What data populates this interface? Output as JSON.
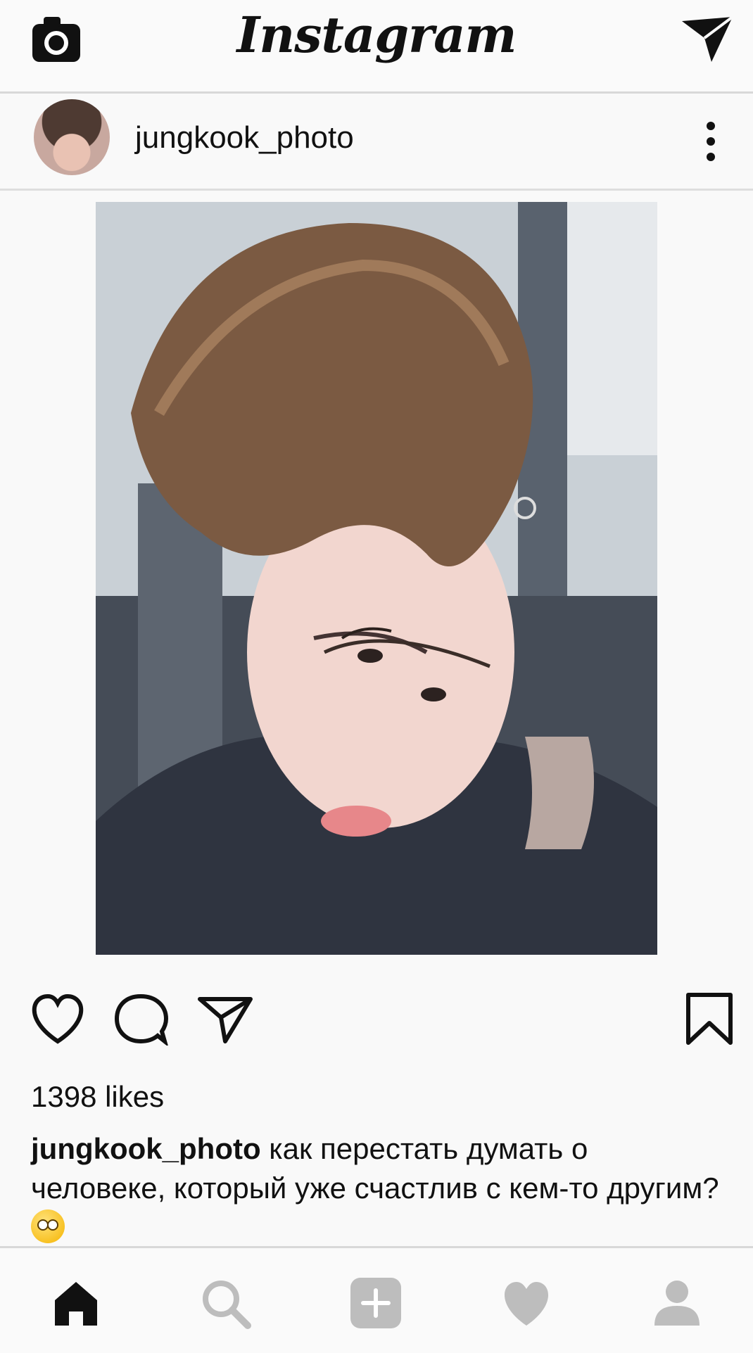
{
  "header": {
    "logo": "Instagram"
  },
  "post": {
    "username": "jungkook_photo",
    "likes": "1398 likes",
    "caption_user": "jungkook_photo",
    "caption_text": " как перестать думать о человеке, который уже счастлив с кем-то другим?"
  },
  "icons": {
    "top": [
      "camera-icon",
      "direct-message-icon"
    ],
    "actions": [
      "heart-icon",
      "comment-icon",
      "share-icon",
      "bookmark-icon"
    ],
    "bottom_nav": [
      "home-icon",
      "search-icon",
      "add-post-icon",
      "activity-heart-icon",
      "profile-icon"
    ],
    "caption_emoji": "face-with-rolling-eyes-emoji"
  },
  "colors": {
    "active_icon": "#111111",
    "inactive_icon": "#bdbdbd",
    "divider": "#d8d8d8"
  }
}
